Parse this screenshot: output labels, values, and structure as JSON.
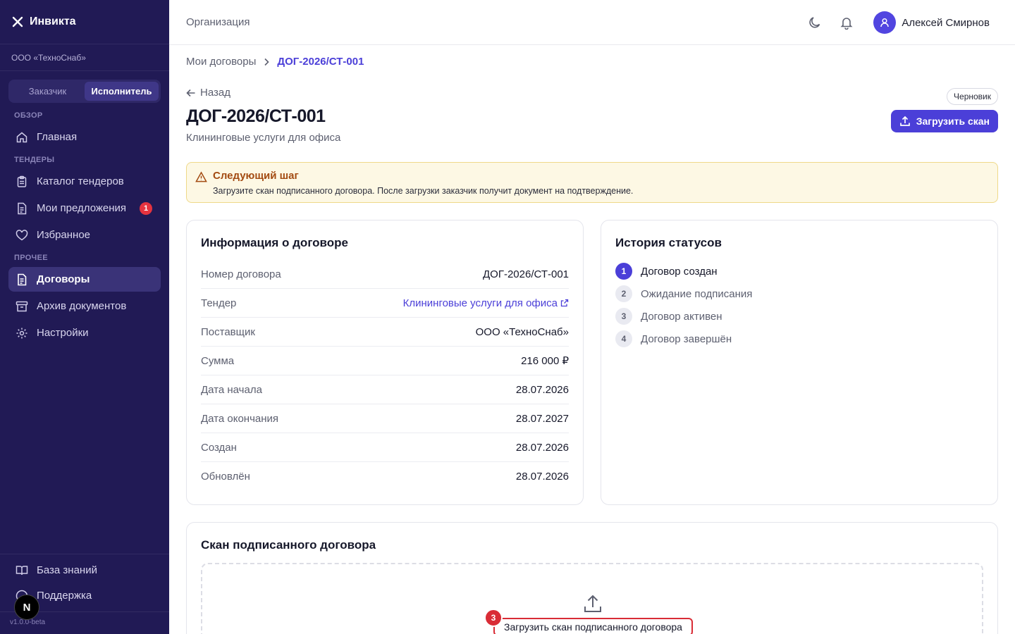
{
  "app": {
    "name": "Инвикта",
    "org": "ООО «ТехноСнаб»",
    "version": "v1.0.0-beta",
    "nextjs_badge": "N"
  },
  "roles": {
    "customer": "Заказчик",
    "executor": "Исполнитель",
    "active": "Исполнитель"
  },
  "sidebar": {
    "sections": {
      "overview": "ОБЗОР",
      "tenders": "ТЕНДЕРЫ",
      "other": "ПРОЧЕЕ"
    },
    "items": {
      "home": {
        "label": "Главная",
        "icon": "home-icon"
      },
      "catalog": {
        "label": "Каталог тендеров",
        "icon": "clipboard-icon"
      },
      "offers": {
        "label": "Мои предложения",
        "icon": "file-icon",
        "badge": "1"
      },
      "favorites": {
        "label": "Избранное",
        "icon": "heart-icon"
      },
      "contracts": {
        "label": "Договоры",
        "icon": "document-icon",
        "active": true
      },
      "archive": {
        "label": "Архив документов",
        "icon": "archive-icon"
      },
      "settings": {
        "label": "Настройки",
        "icon": "gear-icon"
      }
    },
    "bottom": {
      "knowledge": "База знаний",
      "support": "Поддержка"
    }
  },
  "topbar": {
    "title": "Организация",
    "user_name": "Алексей Смирнов"
  },
  "breadcrumb": {
    "parent": "Мои договоры",
    "current": "ДОГ-2026/СТ-001"
  },
  "page": {
    "back": "Назад",
    "title": "ДОГ-2026/СТ-001",
    "subtitle": "Клининговые услуги для офиса",
    "status": "Черновик",
    "upload_button": "Загрузить скан"
  },
  "alert": {
    "title": "Следующий шаг",
    "text": "Загрузите скан подписанного договора. После загрузки заказчик получит документ на подтверждение.",
    "color": "#a34b12"
  },
  "info": {
    "title": "Информация о договоре",
    "rows": [
      {
        "k": "Номер договора",
        "v": "ДОГ-2026/СТ-001"
      },
      {
        "k": "Тендер",
        "v": "Клининговые услуги для офиса",
        "link": true
      },
      {
        "k": "Поставщик",
        "v": "ООО «ТехноСнаб»"
      },
      {
        "k": "Сумма",
        "v": "216 000 ₽"
      },
      {
        "k": "Дата начала",
        "v": "28.07.2026"
      },
      {
        "k": "Дата окончания",
        "v": "28.07.2027"
      },
      {
        "k": "Создан",
        "v": "28.07.2026"
      },
      {
        "k": "Обновлён",
        "v": "28.07.2026"
      }
    ]
  },
  "history": {
    "title": "История статусов",
    "steps": [
      {
        "n": "1",
        "label": "Договор создан",
        "done": true
      },
      {
        "n": "2",
        "label": "Ожидание подписания"
      },
      {
        "n": "3",
        "label": "Договор активен"
      },
      {
        "n": "4",
        "label": "Договор завершён"
      }
    ]
  },
  "scan": {
    "title": "Скан подписанного договора",
    "button": "Загрузить скан подписанного договора",
    "marker": "3"
  },
  "colors": {
    "sidebar": "#211a55",
    "accent": "#4b3fd8",
    "badge": "#e5333f"
  }
}
